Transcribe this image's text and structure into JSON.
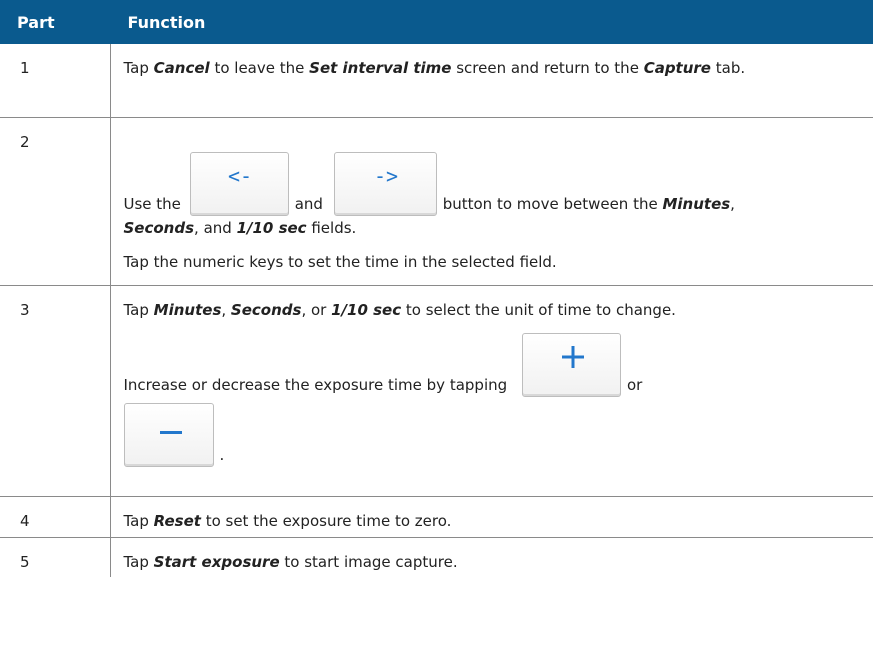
{
  "header": {
    "col1": "Part",
    "col2": "Function"
  },
  "rows": [
    {
      "part": "1",
      "pre": "Tap ",
      "b1": "Cancel",
      "mid1": " to leave the ",
      "b2": "Set interval time",
      "mid2": " screen and return to the ",
      "b3": "Capture",
      "end": " tab."
    },
    {
      "part": "2",
      "use_the": "Use the",
      "and": "and",
      "button_text": "button to move between the ",
      "b1": "Minutes",
      "sep1": ",",
      "b2": "Seconds",
      "sep2": ", and ",
      "b3": "1/10 sec",
      "end": " fields.",
      "para2": "Tap the numeric keys to set the time in the selected field.",
      "left_arrow_icon": "left-arrow-icon",
      "right_arrow_icon": "right-arrow-icon"
    },
    {
      "part": "3",
      "pre": "Tap ",
      "b1": "Minutes",
      "sep1": ", ",
      "b2": "Seconds",
      "sep2": ", or ",
      "b3": "1/10 sec",
      "end": " to select the unit of time to change.",
      "para2": "Increase or decrease the exposure time by tapping",
      "or": "or",
      "period": ".",
      "plus_icon": "plus-icon",
      "minus_icon": "minus-icon",
      "icon_color": "#2277cc"
    },
    {
      "part": "4",
      "pre": "Tap ",
      "b1": "Reset",
      "end": " to set the exposure time to zero."
    },
    {
      "part": "5",
      "pre": "Tap ",
      "b1": "Start exposure",
      "end": " to start image capture."
    }
  ],
  "colors": {
    "header_bg": "#0a5a8e",
    "header_text": "#ffffff",
    "rule": "#8a8a8a"
  }
}
